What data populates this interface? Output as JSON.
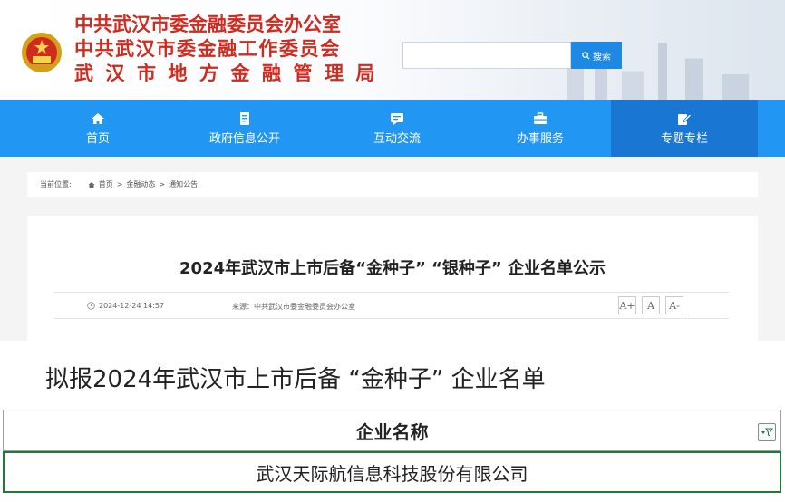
{
  "header": {
    "org_lines": [
      "中共武汉市委金融委员会办公室",
      "中共武汉市委金融工作委员会",
      "武汉市地方金融管理局"
    ],
    "emblem_icon": "national-emblem-icon",
    "search": {
      "placeholder": "",
      "button_label": "搜索",
      "icon": "search-icon"
    }
  },
  "nav": {
    "items": [
      {
        "label": "首页",
        "icon": "home-icon"
      },
      {
        "label": "政府信息公开",
        "icon": "document-icon"
      },
      {
        "label": "互动交流",
        "icon": "chat-icon"
      },
      {
        "label": "办事服务",
        "icon": "briefcase-icon"
      },
      {
        "label": "专题专栏",
        "icon": "edit-icon"
      }
    ],
    "active_index": 4
  },
  "breadcrumb": {
    "prefix": "当前位置:",
    "items": [
      "首页",
      "金融动态",
      "通知公告"
    ],
    "separator": ">"
  },
  "article": {
    "title": "2024年武汉市上市后备“金种子” “银种子” 企业名单公示",
    "date": "2024-12-24 14:57",
    "source": "来源：中共武汉市委金融委员会办公室",
    "font_buttons": [
      "A+",
      "A",
      "A-"
    ]
  },
  "content": {
    "heading": "拟报2024年武汉市上市后备 “金种子” 企业名单",
    "table": {
      "header": "企业名称",
      "rows": [
        "武汉天际航信息科技股份有限公司"
      ]
    }
  },
  "colors": {
    "brand_red": "#d12a1f",
    "nav_blue": "#2196f3",
    "nav_active": "#1976d2",
    "selection_green": "#1e7a3a"
  }
}
